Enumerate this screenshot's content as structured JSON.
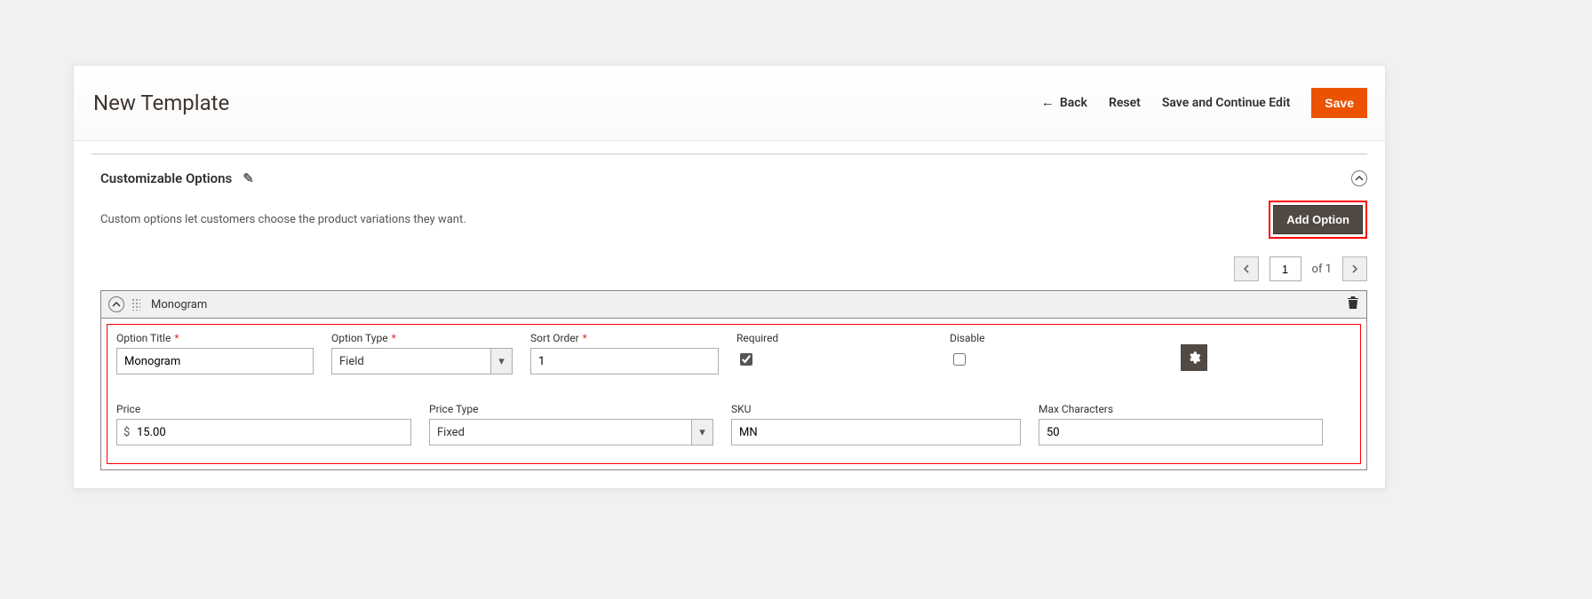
{
  "header": {
    "title": "New Template",
    "back": "Back",
    "reset": "Reset",
    "save_continue": "Save and Continue Edit",
    "save": "Save"
  },
  "section": {
    "title": "Customizable Options",
    "description": "Custom options let customers choose the product variations they want.",
    "add_option": "Add Option"
  },
  "pager": {
    "page": "1",
    "of_label": "of 1"
  },
  "option": {
    "name": "Monogram",
    "fields": {
      "option_title_label": "Option Title",
      "option_title_value": "Monogram",
      "option_type_label": "Option Type",
      "option_type_value": "Field",
      "sort_order_label": "Sort Order",
      "sort_order_value": "1",
      "required_label": "Required",
      "required_checked": true,
      "disable_label": "Disable",
      "disable_checked": false,
      "price_label": "Price",
      "price_value": "15.00",
      "price_type_label": "Price Type",
      "price_type_value": "Fixed",
      "sku_label": "SKU",
      "sku_value": "MN",
      "max_chars_label": "Max Characters",
      "max_chars_value": "50"
    }
  },
  "currency_symbol": "$"
}
